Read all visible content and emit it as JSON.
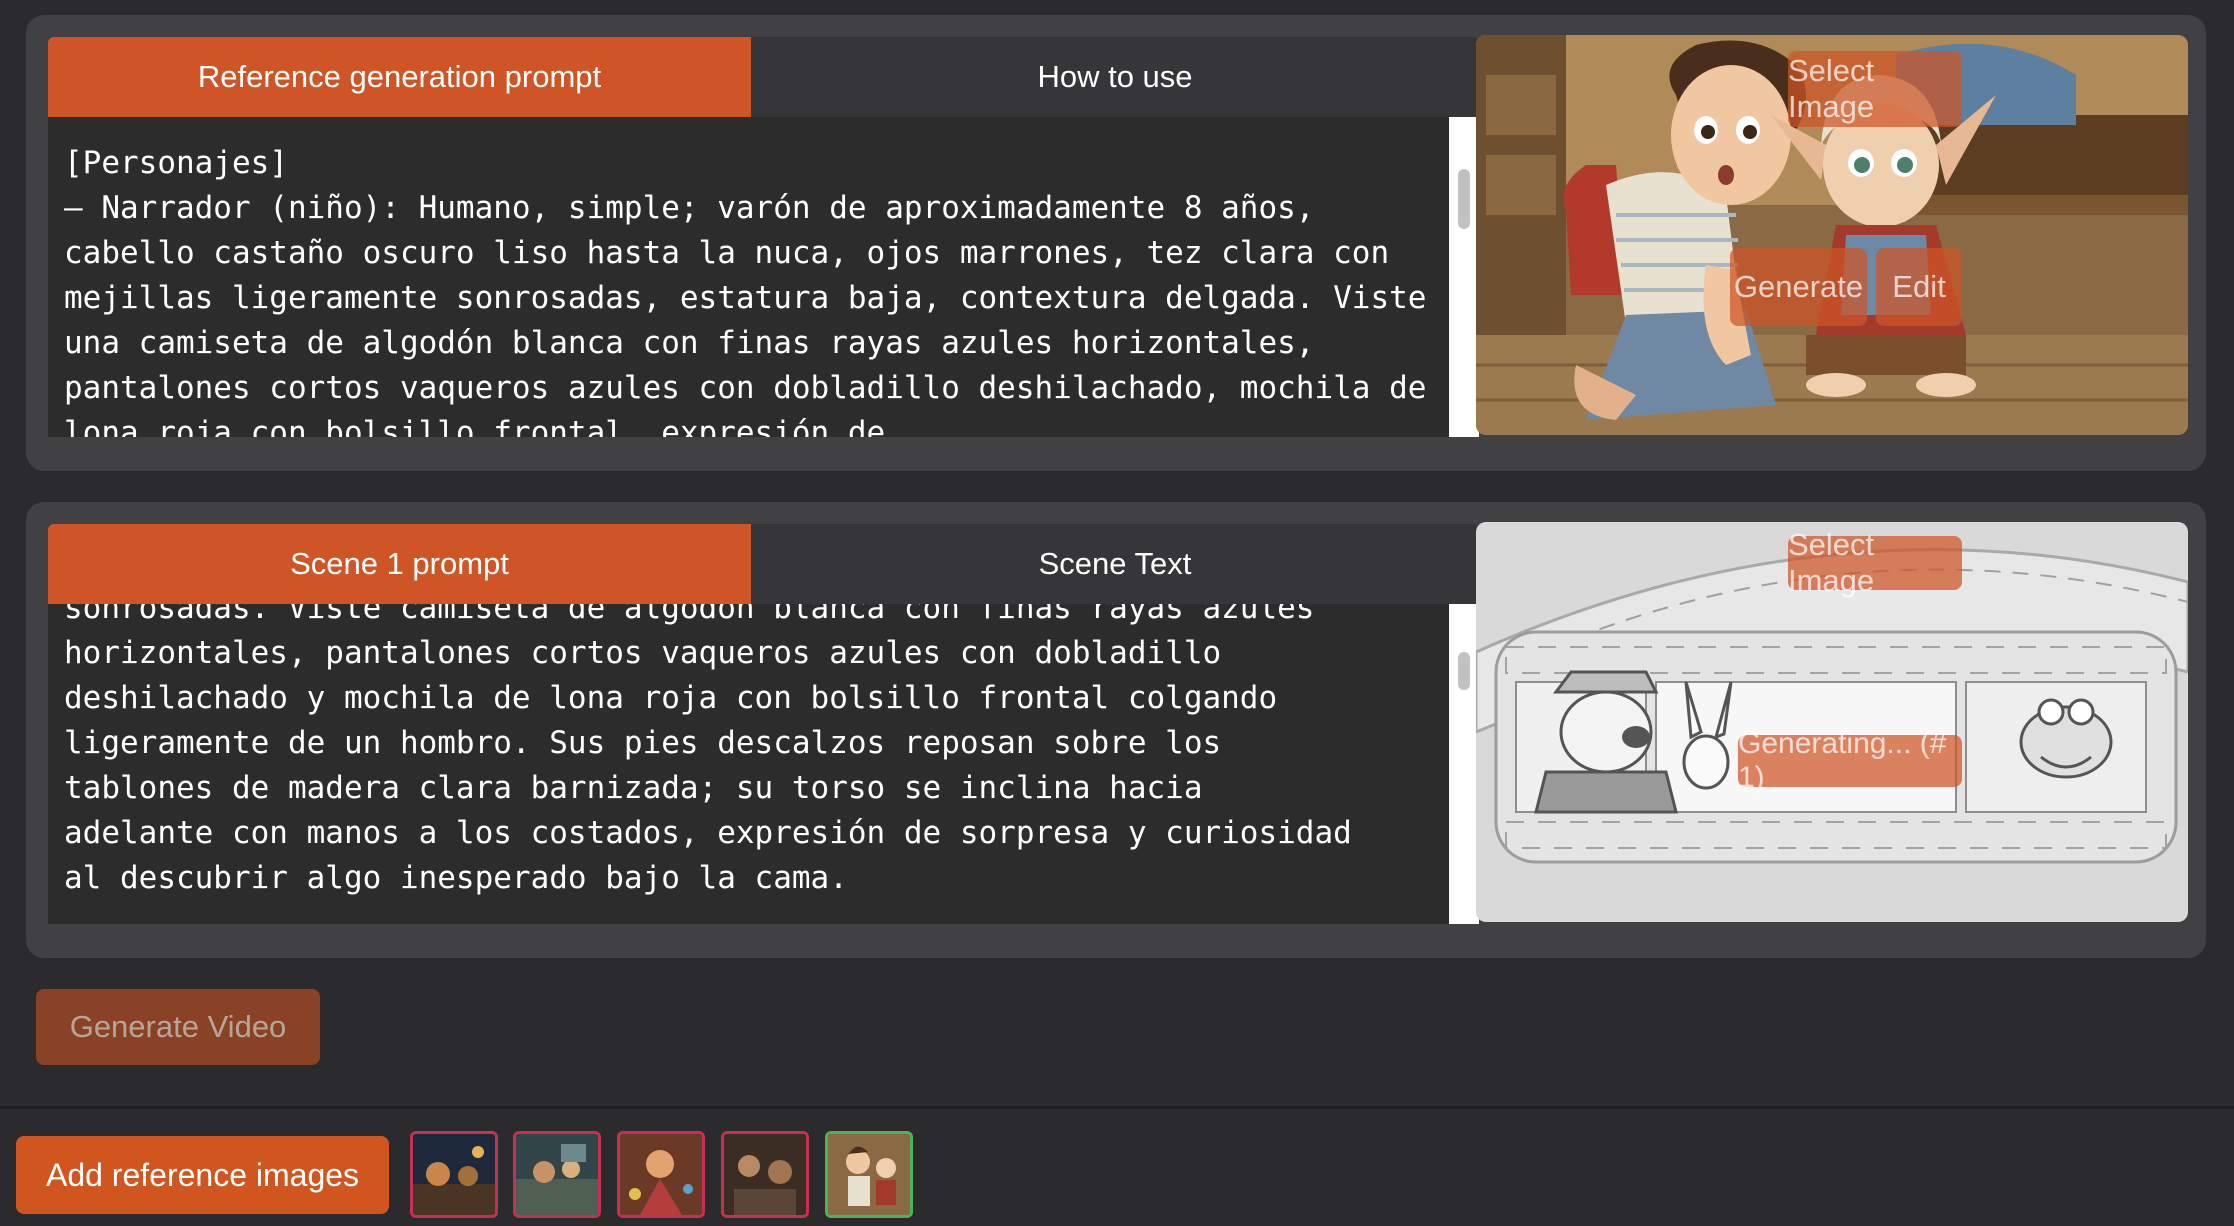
{
  "reference_panel": {
    "tabs": [
      "Reference generation prompt",
      "How to use"
    ],
    "text": "[Personajes]\n– Narrador (niño): Humano, simple; varón de aproximadamente 8 años, cabello castaño oscuro liso hasta la nuca, ojos marrones, tez clara con mejillas ligeramente sonrosadas, estatura baja, contextura delgada. Viste una camiseta de algodón blanca con finas rayas azules horizontales, pantalones cortos vaqueros azules con dobladillo deshilachado, mochila de lona roja con bolsillo frontal, expresión de",
    "buttons": {
      "select_image": "Select Image",
      "generate": "Generate",
      "edit": "Edit"
    }
  },
  "scene_panel": {
    "tabs": [
      "Scene 1 prompt",
      "Scene Text"
    ],
    "text": "sonrosadas. Viste camiseta de algodón blanca con finas rayas azules\nhorizontales, pantalones cortos vaqueros azules con dobladillo\ndeshilachado y mochila de lona roja con bolsillo frontal colgando\nligeramente de un hombro. Sus pies descalzos reposan sobre los\ntablones de madera clara barnizada; su torso se inclina hacia\nadelante con manos a los costados, expresión de sorpresa y curiosidad\nal descubrir algo inesperado bajo la cama.",
    "buttons": {
      "select_image": "Select Image",
      "generating": "Generating... (# 1)"
    }
  },
  "generate_video_label": "Generate Video",
  "add_reference_label": "Add reference images",
  "colors": {
    "accent": "#cf5526",
    "background": "#2b2a2c",
    "panel": "#414042",
    "thumb_border": "#c5324f",
    "thumb_selected_border": "#4bb35a"
  }
}
